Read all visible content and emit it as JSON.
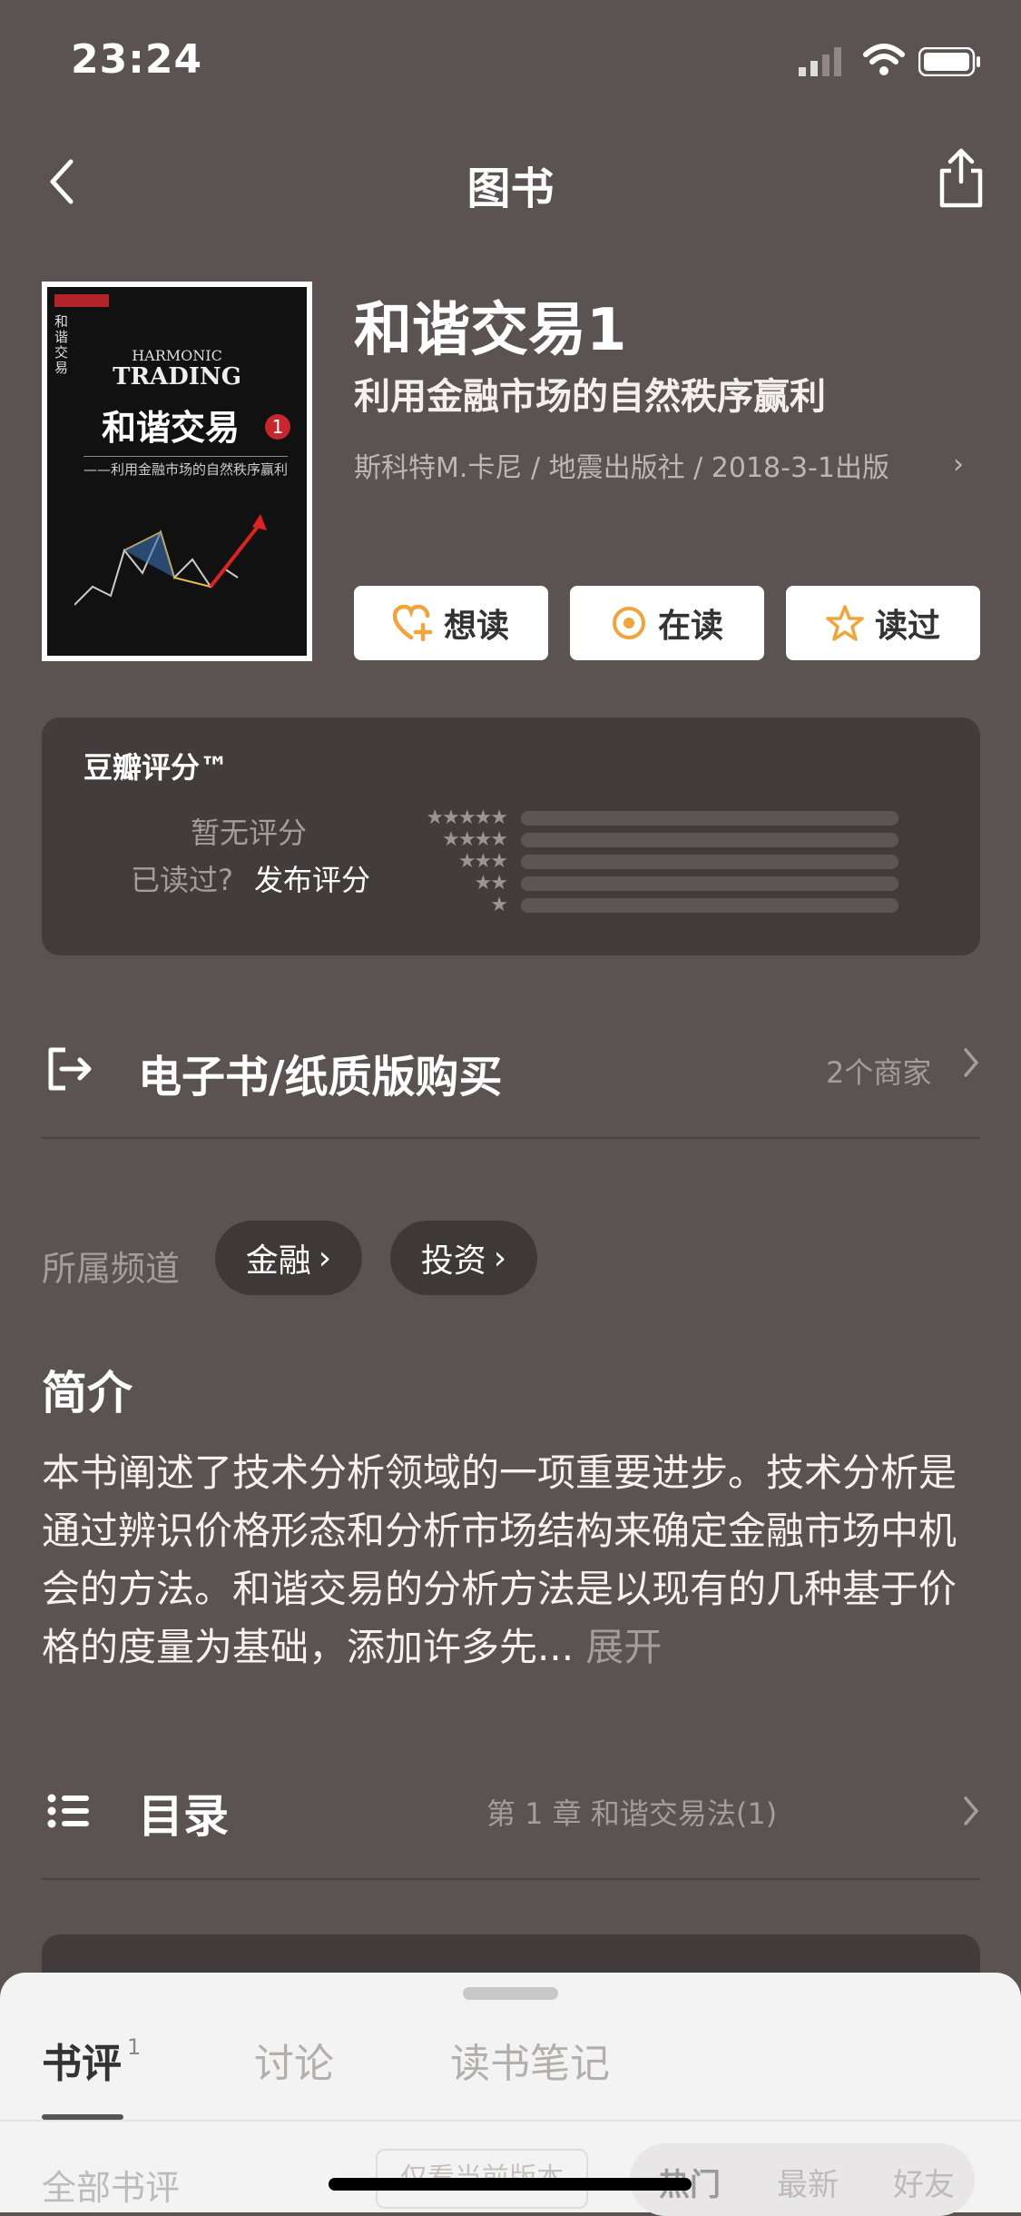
{
  "status_bar": {
    "time": "23:24"
  },
  "nav": {
    "title": "图书"
  },
  "book": {
    "cover": {
      "en_line1": "HARMONIC",
      "en_line2": "TRADING",
      "cn_title": "和谐交易",
      "number": "1",
      "subtitle": "——利用金融市场的自然秩序赢利"
    },
    "title": "和谐交易1",
    "subtitle": "利用金融市场的自然秩序赢利",
    "meta": "斯科特M.卡尼 / 地震出版社 / 2018-3-1出版"
  },
  "actions": {
    "want": "想读",
    "reading": "在读",
    "read": "读过"
  },
  "rating": {
    "title": "豆瓣评分™",
    "no_rating": "暂无评分",
    "read_prompt": "已读过?",
    "post": "发布评分",
    "stars": [
      "★★★★★",
      "★★★★",
      "★★★",
      "★★",
      "★"
    ]
  },
  "ebook": {
    "label": "电子书/纸质版购买",
    "count": "2个商家"
  },
  "channels": {
    "label": "所属频道",
    "items": [
      "金融",
      "投资"
    ]
  },
  "intro": {
    "title": "简介",
    "text": "本书阐述了技术分析领域的一项重要进步。技术分析是通过辨识价格形态和分析市场结构来确定金融市场中机会的方法。和谐交易的分析方法是以现有的几种基于价格的度量为基础，添加许多先...",
    "more": "展开"
  },
  "toc": {
    "label": "目录",
    "chapter": "第 1 章 和谐交易法(1)"
  },
  "sheet": {
    "tabs": {
      "review": "书评",
      "review_count": "1",
      "discuss": "讨论",
      "notes": "读书笔记"
    },
    "all_reviews": "全部书评",
    "filter": "仅看当前版本",
    "sort": {
      "hot": "热门",
      "new": "最新",
      "friend": "好友"
    }
  },
  "colors": {
    "background": "#5a5352",
    "card": "#433c3c",
    "accent_star": "#f2a33a"
  }
}
